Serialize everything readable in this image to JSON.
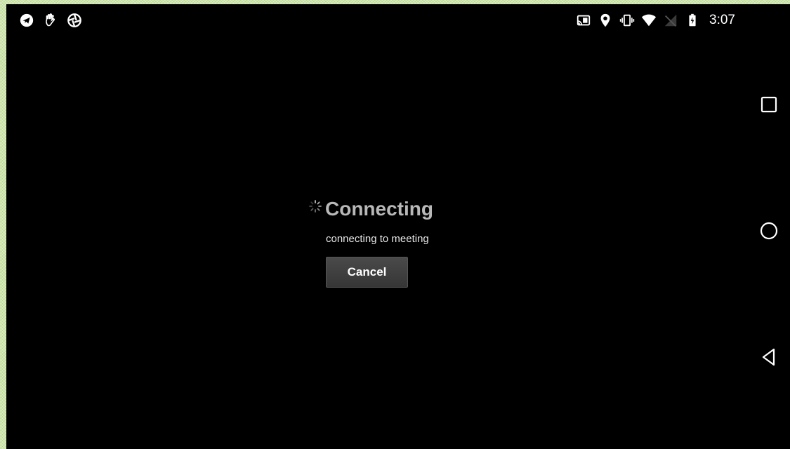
{
  "status_bar": {
    "left_icons": [
      "telegram-icon",
      "hand-icon",
      "aperture-icon"
    ],
    "right_icons": [
      "cast-icon",
      "location-icon",
      "vibrate-icon",
      "wifi-icon",
      "no-signal-icon",
      "battery-icon"
    ],
    "time": "3:07"
  },
  "dialog": {
    "title": "Connecting",
    "message": "connecting to meeting",
    "cancel_label": "Cancel"
  },
  "nav_bar": {
    "buttons": [
      "recents-icon",
      "home-icon",
      "back-icon"
    ]
  },
  "colors": {
    "background": "#000000",
    "title": "#b8b8b8",
    "button": "#404040",
    "frame": "#cfe6ad"
  }
}
